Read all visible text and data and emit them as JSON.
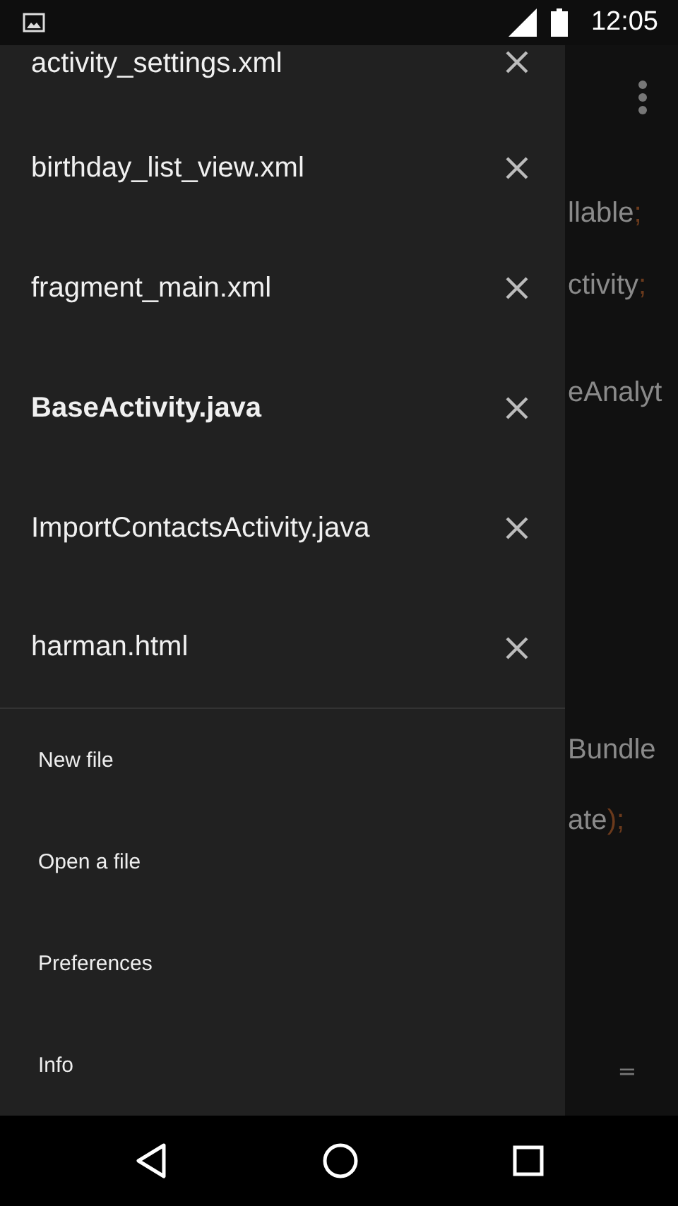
{
  "status_bar": {
    "time": "12:05"
  },
  "drawer": {
    "files": [
      {
        "name": "activity_settings.xml",
        "selected": false
      },
      {
        "name": "birthday_list_view.xml",
        "selected": false
      },
      {
        "name": "fragment_main.xml",
        "selected": false
      },
      {
        "name": "BaseActivity.java",
        "selected": true
      },
      {
        "name": "ImportContactsActivity.java",
        "selected": false
      },
      {
        "name": "harman.html",
        "selected": false
      }
    ],
    "menu": [
      "New file",
      "Open a file",
      "Preferences",
      "Info"
    ]
  },
  "editor": {
    "lines": [
      {
        "kind": "code",
        "text": "llable",
        "punct": ";"
      },
      {
        "kind": "blank"
      },
      {
        "kind": "code",
        "text": "ctivity",
        "punct": ";"
      },
      {
        "kind": "blank"
      },
      {
        "kind": "blank"
      },
      {
        "kind": "code",
        "text": "eAnalyt"
      },
      {
        "kind": "blank"
      },
      {
        "kind": "blank"
      },
      {
        "kind": "blank"
      },
      {
        "kind": "blank"
      },
      {
        "kind": "blank"
      },
      {
        "kind": "blank"
      },
      {
        "kind": "blank"
      },
      {
        "kind": "blank"
      },
      {
        "kind": "blank"
      },
      {
        "kind": "code",
        "text": "Bundle"
      },
      {
        "kind": "blank"
      },
      {
        "kind": "code",
        "text": "ate",
        "punct": ");"
      }
    ],
    "bottom_key": "="
  }
}
